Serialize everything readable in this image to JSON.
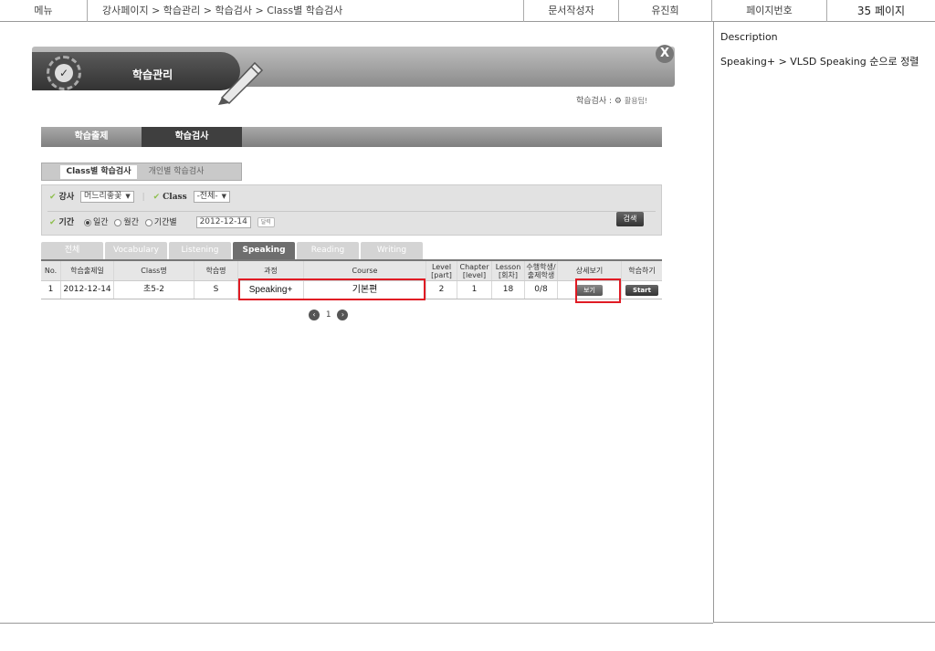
{
  "header": {
    "menu": "메뉴",
    "path": "강사페이지 > 학습관리 > 학습검사 > Class별 학습검사",
    "author_label": "문서작성자",
    "author": "유진희",
    "page_label": "페이지번호",
    "page": "35 페이지"
  },
  "side": {
    "title": "Description",
    "text": "Speaking+ > VLSD Speaking 순으로 정렬"
  },
  "window": {
    "title": "학습관리",
    "close": "X",
    "crumb": "학습검사 :",
    "crumb_hint": "활용팁!"
  },
  "main_tabs": [
    "학습출제",
    "학습검사"
  ],
  "sub_tabs": [
    "Class별 학습검사",
    "개인별 학습검사"
  ],
  "filter": {
    "teacher_label": "강사",
    "teacher_value": "머느리좋꽃",
    "class_label": "Class",
    "class_value": "-전체-",
    "period_label": "기간",
    "period_options": [
      "일간",
      "월간",
      "기간별"
    ],
    "date": "2012-12-14",
    "calendar": "달력",
    "search": "검색"
  },
  "skill_tabs": [
    "전체",
    "Vocabulary",
    "Listening",
    "Speaking",
    "Reading",
    "Writing"
  ],
  "table": {
    "headers": [
      "No.",
      "학습출제일",
      "Class명",
      "학습명",
      "과정",
      "Course",
      "Level [part]",
      "Chapter [level]",
      "Lesson [회차]",
      "수행학생/ 출제학생",
      "상세보기",
      "학습하기"
    ],
    "row": {
      "no": "1",
      "date": "2012-12-14",
      "class": "초5-2",
      "name": "S",
      "process": "Speaking+",
      "course": "기본편",
      "level": "2",
      "chapter": "1",
      "lesson": "18",
      "students": "0/8",
      "detail": "보기",
      "start": "Start"
    }
  },
  "pager": {
    "prev": "‹",
    "page": "1",
    "next": "›"
  },
  "colors": {
    "highlight": "#e01b24",
    "check": "#8fbf4f"
  }
}
